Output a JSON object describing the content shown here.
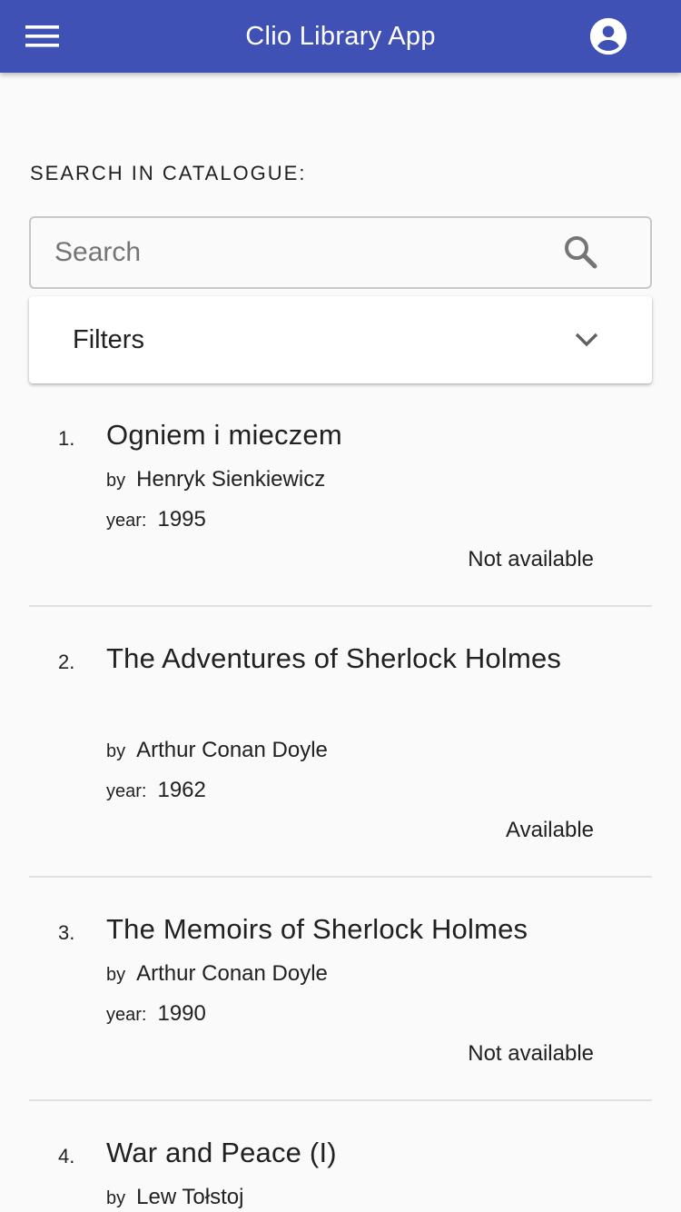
{
  "appbar": {
    "title": "Clio Library App",
    "background": "#3f51b5"
  },
  "search": {
    "section_label": "SEARCH IN CATALOGUE:",
    "placeholder": "Search",
    "value": ""
  },
  "filters": {
    "label": "Filters"
  },
  "labels": {
    "by": "by",
    "year": "year:"
  },
  "books": [
    {
      "number": "1.",
      "title": "Ogniem i mieczem",
      "author": "Henryk Sienkiewicz",
      "year": "1995",
      "status": "Not available"
    },
    {
      "number": "2.",
      "title": "The Adventures of Sherlock Holmes",
      "author": "Arthur Conan Doyle",
      "year": "1962",
      "status": "Available"
    },
    {
      "number": "3.",
      "title": "The Memoirs of Sherlock Holmes",
      "author": "Arthur Conan Doyle",
      "year": "1990",
      "status": "Not available"
    },
    {
      "number": "4.",
      "title": "War and Peace (I)",
      "author": "Lew Tołstoj",
      "year": "",
      "status": ""
    }
  ],
  "icons": {
    "menu": "hamburger-menu-icon",
    "account": "account-circle-icon",
    "search": "magnifier-icon",
    "chevron": "chevron-down-icon"
  }
}
